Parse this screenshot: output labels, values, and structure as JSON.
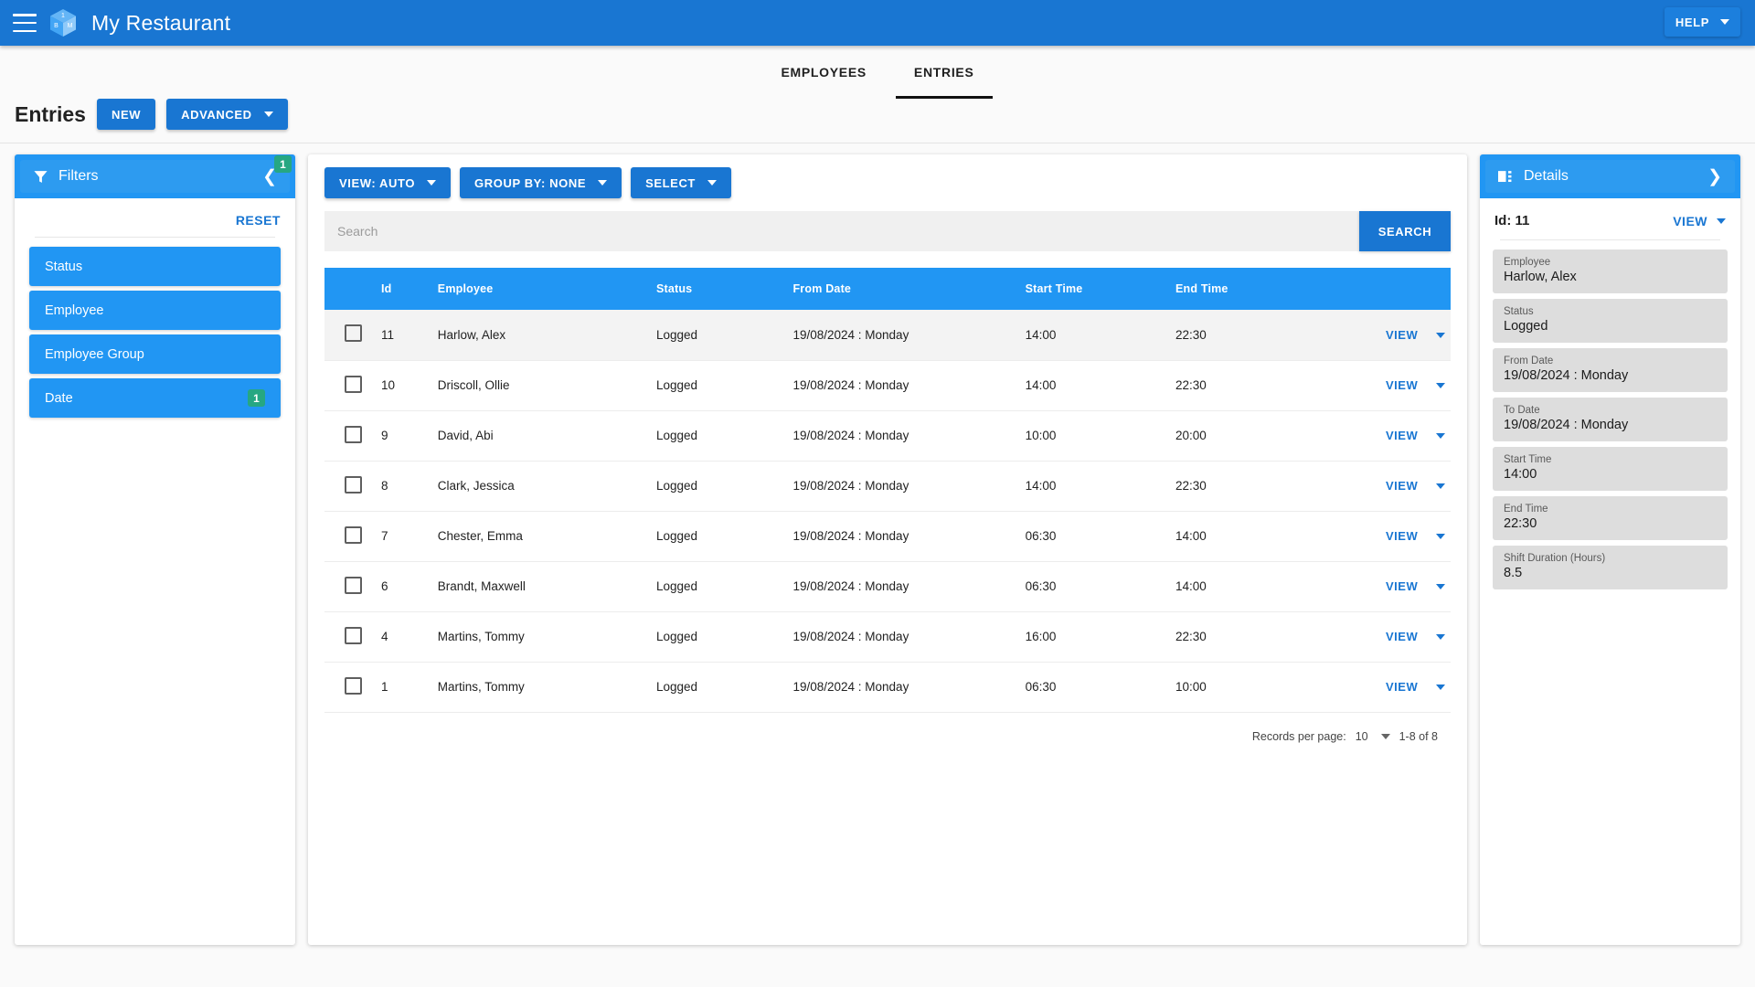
{
  "topbar": {
    "menu_icon": "hamburger-menu-icon",
    "logo": {
      "icon": "cube-logo-icon",
      "top_face": "1",
      "left_face": "B",
      "right_face": "M"
    },
    "app_title": "My Restaurant",
    "help_label": "HELP"
  },
  "tabs": [
    {
      "label": "EMPLOYEES",
      "active": false
    },
    {
      "label": "ENTRIES",
      "active": true
    }
  ],
  "page_header": {
    "title": "Entries",
    "new_label": "NEW",
    "advanced_label": "ADVANCED"
  },
  "filters": {
    "title": "Filters",
    "icon": "funnel-icon",
    "badge": "1",
    "collapse_icon": "chevron-left-icon",
    "reset_label": "RESET",
    "items": [
      {
        "label": "Status",
        "badge": ""
      },
      {
        "label": "Employee",
        "badge": ""
      },
      {
        "label": "Employee Group",
        "badge": ""
      },
      {
        "label": "Date",
        "badge": "1"
      }
    ]
  },
  "toolbar": {
    "view_label": "VIEW: AUTO",
    "group_by_label": "GROUP BY: NONE",
    "select_label": "SELECT"
  },
  "search": {
    "value": "",
    "placeholder": "Search",
    "button_label": "SEARCH"
  },
  "table": {
    "columns": [
      "",
      "Id",
      "Employee",
      "Status",
      "From Date",
      "Start Time",
      "End Time",
      ""
    ],
    "row_action_label": "VIEW",
    "rows": [
      {
        "id": "11",
        "employee": "Harlow, Alex",
        "status": "Logged",
        "from_date": "19/08/2024 : Monday",
        "start_time": "14:00",
        "end_time": "22:30",
        "selected": true
      },
      {
        "id": "10",
        "employee": "Driscoll, Ollie",
        "status": "Logged",
        "from_date": "19/08/2024 : Monday",
        "start_time": "14:00",
        "end_time": "22:30",
        "selected": false
      },
      {
        "id": "9",
        "employee": "David, Abi",
        "status": "Logged",
        "from_date": "19/08/2024 : Monday",
        "start_time": "10:00",
        "end_time": "20:00",
        "selected": false
      },
      {
        "id": "8",
        "employee": "Clark, Jessica",
        "status": "Logged",
        "from_date": "19/08/2024 : Monday",
        "start_time": "14:00",
        "end_time": "22:30",
        "selected": false
      },
      {
        "id": "7",
        "employee": "Chester, Emma",
        "status": "Logged",
        "from_date": "19/08/2024 : Monday",
        "start_time": "06:30",
        "end_time": "14:00",
        "selected": false
      },
      {
        "id": "6",
        "employee": "Brandt, Maxwell",
        "status": "Logged",
        "from_date": "19/08/2024 : Monday",
        "start_time": "06:30",
        "end_time": "14:00",
        "selected": false
      },
      {
        "id": "4",
        "employee": "Martins, Tommy",
        "status": "Logged",
        "from_date": "19/08/2024 : Monday",
        "start_time": "16:00",
        "end_time": "22:30",
        "selected": false
      },
      {
        "id": "1",
        "employee": "Martins, Tommy",
        "status": "Logged",
        "from_date": "19/08/2024 : Monday",
        "start_time": "06:30",
        "end_time": "10:00",
        "selected": false
      }
    ]
  },
  "pagination": {
    "records_per_page_label": "Records per page:",
    "records_per_page_value": "10",
    "range_label": "1-8 of 8"
  },
  "details": {
    "title": "Details",
    "icon": "details-panel-icon",
    "expand_icon": "chevron-right-icon",
    "id_label": "Id: 11",
    "view_label": "VIEW",
    "fields": [
      {
        "label": "Employee",
        "value": "Harlow, Alex"
      },
      {
        "label": "Status",
        "value": "Logged"
      },
      {
        "label": "From Date",
        "value": "19/08/2024 : Monday"
      },
      {
        "label": "To Date",
        "value": "19/08/2024 : Monday"
      },
      {
        "label": "Start Time",
        "value": "14:00"
      },
      {
        "label": "End Time",
        "value": "22:30"
      },
      {
        "label": "Shift Duration (Hours)",
        "value": "8.5"
      }
    ]
  },
  "colors": {
    "primary_blue": "#1976d2",
    "panel_blue": "#2196f3",
    "badge_green": "#26a782",
    "link_blue": "#1976d2",
    "page_bg": "#fafafa"
  }
}
